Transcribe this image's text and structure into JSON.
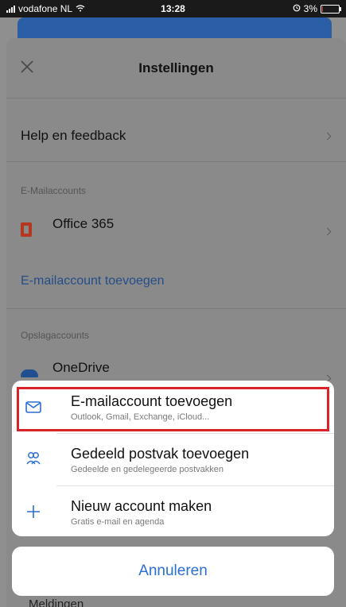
{
  "status_bar": {
    "carrier": "vodafone NL",
    "time": "13:28",
    "battery_text": "3%",
    "battery_level": 0.03
  },
  "header": {
    "title": "Instellingen"
  },
  "settings": {
    "help_label": "Help en feedback",
    "email_section_label": "E-Mailaccounts",
    "office_label": "Office 365",
    "add_email_link": "E-mailaccount toevoegen",
    "storage_section_label": "Opslagaccounts",
    "onedrive_label": "OneDrive",
    "peek_label": "Meldingen"
  },
  "action_sheet": {
    "items": [
      {
        "title": "E-mailaccount toevoegen",
        "subtitle": "Outlook, Gmail, Exchange, iCloud...",
        "icon": "envelope-icon"
      },
      {
        "title": "Gedeeld postvak toevoegen",
        "subtitle": "Gedeelde en gedelegeerde postvakken",
        "icon": "shared-people-icon"
      },
      {
        "title": "Nieuw account maken",
        "subtitle": "Gratis e-mail en agenda",
        "icon": "plus-icon"
      }
    ],
    "cancel_label": "Annuleren"
  },
  "colors": {
    "accent": "#2a6fd2",
    "highlight": "#d8232a",
    "overlay": "#8a8a8a"
  }
}
